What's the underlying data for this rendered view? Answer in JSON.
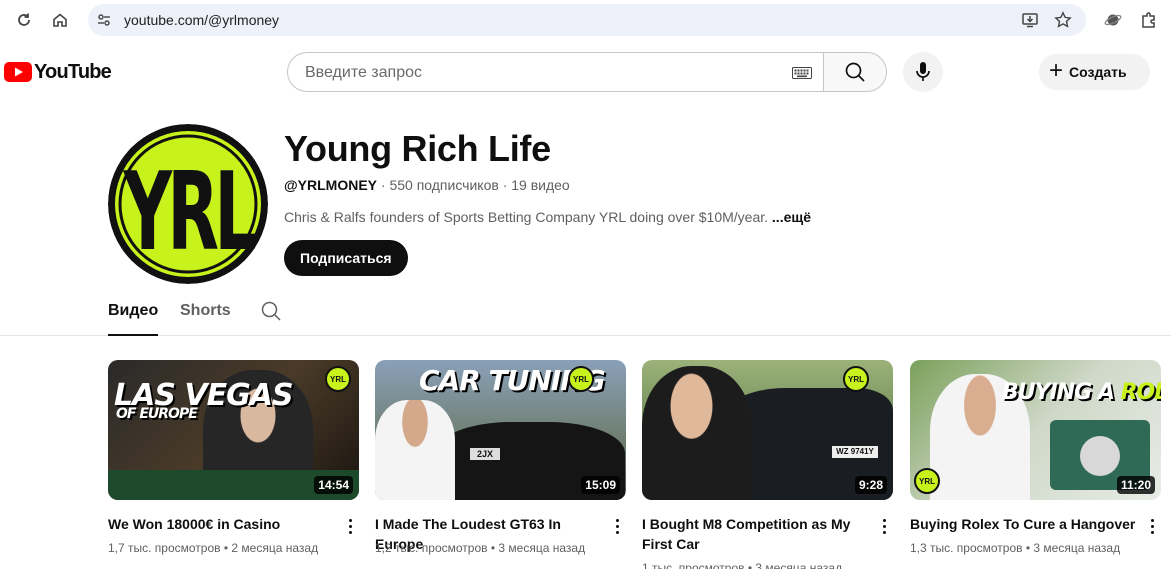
{
  "browser": {
    "url": "youtube.com/@yrlmoney"
  },
  "masthead": {
    "logo_text": "YouTube",
    "search_placeholder": "Введите запрос",
    "create_label": "Создать"
  },
  "channel": {
    "name": "Young Rich Life",
    "handle": "@YRLMONEY",
    "subscribers": "550 подписчиков",
    "videos_count": "19 видео",
    "description": "Chris & Ralfs founders of Sports Betting Company YRL doing over $10M/year.",
    "more_label": "...ещё",
    "subscribe_label": "Подписаться",
    "avatar_text": "YRL"
  },
  "tabs": [
    {
      "label": "Видео",
      "active": true
    },
    {
      "label": "Shorts",
      "active": false
    }
  ],
  "videos": [
    {
      "title": "We Won 18000€ in Casino",
      "duration": "14:54",
      "views": "1,7 тыс. просмотров",
      "age": "2 месяца назад",
      "thumb_line1": "LAS VEGAS",
      "thumb_line2": "OF EUROPE",
      "badge": "YRL"
    },
    {
      "title": "I Made The Loudest GT63 In Europe",
      "duration": "15:09",
      "views": "1,2 тыс. просмотров",
      "age": "3 месяца назад",
      "thumb_line1": "CAR TUNING",
      "badge": "YRL",
      "plate": "2JX"
    },
    {
      "title": "I Bought M8 Competition as My First Car",
      "duration": "9:28",
      "views": "1 тыс. просмотров",
      "age": "3 месяца назад",
      "badge": "YRL",
      "plate": "WZ 9741Y"
    },
    {
      "title": "Buying Rolex To Cure a Hangover",
      "duration": "11:20",
      "views": "1,3 тыс. просмотров",
      "age": "3 месяца назад",
      "thumb_line1": "BUYING A",
      "thumb_line2": "ROLEX",
      "badge": "YRL"
    }
  ],
  "colors": {
    "brand_red": "#ff0000",
    "yrl_green": "#c8f21c",
    "text_primary": "#0f0f0f",
    "text_secondary": "#606060"
  }
}
